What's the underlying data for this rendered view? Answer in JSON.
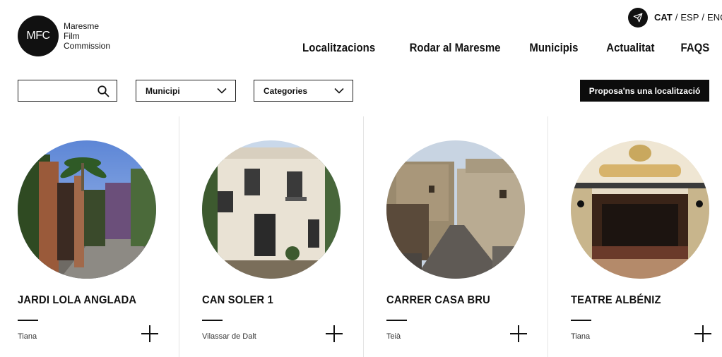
{
  "brand": {
    "logo_initials": "MFC",
    "name_lines": [
      "Maresme",
      "Film",
      "Commission"
    ]
  },
  "icons": {
    "send": "paper-plane-icon",
    "search": "search-icon",
    "dropdown": "chevron-down-icon",
    "add": "plus-icon"
  },
  "languages": {
    "items": [
      "CAT",
      "ESP",
      "ENG"
    ],
    "active": "CAT",
    "separator": "/"
  },
  "nav": {
    "items": [
      "Localitzacions",
      "Rodar al Maresme",
      "Municipis",
      "Actualitat",
      "FAQS"
    ]
  },
  "filters": {
    "search_value": "",
    "municipi_label": "Municipi",
    "categories_label": "Categories",
    "propose_label": "Proposa'ns una localització"
  },
  "colors": {
    "primary": "#0c0c0c",
    "background": "#ffffff",
    "divider": "#e4e4e4"
  },
  "cards": [
    {
      "title": "JARDI LOLA ANGLADA",
      "town": "Tiana"
    },
    {
      "title": "CAN SOLER 1",
      "town": "Vilassar de Dalt"
    },
    {
      "title": "CARRER CASA BRU",
      "town": "Teià"
    },
    {
      "title": "TEATRE ALBÉNIZ",
      "town": "Tiana"
    }
  ]
}
